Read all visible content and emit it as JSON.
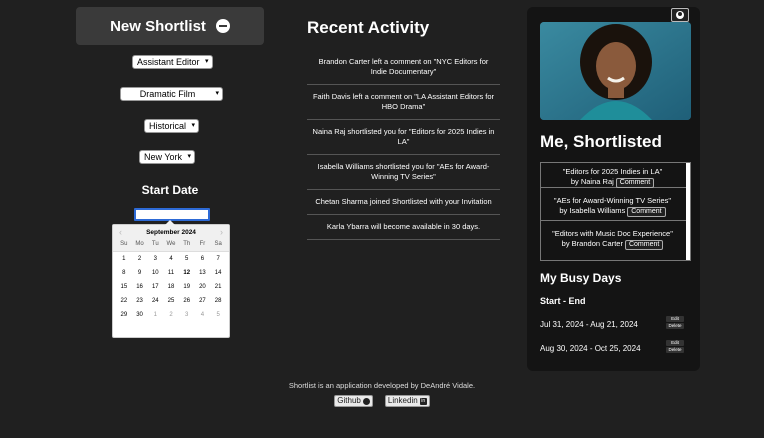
{
  "sidebar": {
    "new_shortlist_label": "New Shortlist",
    "filters": [
      {
        "value": "Assistant Editor"
      },
      {
        "value": "Dramatic Film"
      },
      {
        "value": "Historical"
      },
      {
        "value": "New York"
      }
    ],
    "start_date_label": "Start Date",
    "calendar": {
      "month_label": "September 2024",
      "days_of_week": [
        "Su",
        "Mo",
        "Tu",
        "We",
        "Th",
        "Fr",
        "Sa"
      ],
      "weeks": [
        [
          "1",
          "2",
          "3",
          "4",
          "5",
          "6",
          "7"
        ],
        [
          "8",
          "9",
          "10",
          "11",
          "12",
          "13",
          "14"
        ],
        [
          "15",
          "16",
          "17",
          "18",
          "19",
          "20",
          "21"
        ],
        [
          "22",
          "23",
          "24",
          "25",
          "26",
          "27",
          "28"
        ],
        [
          "29",
          "30",
          "1",
          "2",
          "3",
          "4",
          "5"
        ]
      ],
      "today": "12"
    }
  },
  "activity": {
    "title": "Recent Activity",
    "items": [
      "Brandon Carter left a comment on \"NYC Editors for Indie Documentary\"",
      "Faith Davis left a comment on \"LA Assistant Editors for HBO Drama\"",
      "Naina Raj shortlisted you for \"Editors for 2025 Indies in LA\"",
      "Isabella Williams shortlisted you for \"AEs for Award-Winning TV Series\"",
      "Chetan Sharma joined Shortlisted with your Invitation",
      "Karla Ybarra will become available in 30 days."
    ]
  },
  "profile": {
    "shortlisted_title": "Me, Shortlisted",
    "shortlists": [
      {
        "title": "\"Editors for 2025 Indies in LA\"",
        "by": "by Naina Raj"
      },
      {
        "title": "\"AEs for Award-Winning TV Series\"",
        "by": "by Isabella Williams"
      },
      {
        "title": "\"Editors with Music Doc Experience\"",
        "by": "by Brandon Carter"
      }
    ],
    "comment_label": "Comment",
    "busy_title": "My Busy Days",
    "busy_subtitle": "Start - End",
    "busy_ranges": [
      "Jul 31, 2024 - Aug 21, 2024",
      "Aug 30, 2024 - Oct 25, 2024"
    ],
    "edit_label": "Edit",
    "delete_label": "Delete"
  },
  "footer": {
    "text": "Shortlist is an application developed by DeAndré Vidale.",
    "github_label": "Github",
    "linkedin_label": "Linkedin"
  }
}
